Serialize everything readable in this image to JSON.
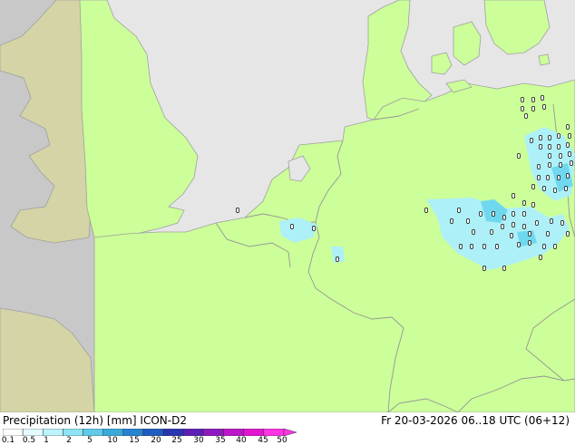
{
  "map": {
    "colors": {
      "land": "#ccff99",
      "sea": "#e6e6e6",
      "outside_domain": "#c8c8c8",
      "outside_domain_land": "#d4d4a6",
      "border": "#969696",
      "coast": "#a0a0a0",
      "precip_light": "#aef0f7",
      "precip_medium": "#70d8ee"
    }
  },
  "footer": {
    "title": "Precipitation (12h) [mm] ICON-D2",
    "valid_time": "Fr 20-03-2026 06..18 UTC (06+12)"
  },
  "legend": {
    "labels": [
      "0.1",
      "0.5",
      "1",
      "2",
      "5",
      "10",
      "15",
      "20",
      "25",
      "30",
      "35",
      "40",
      "45",
      "50"
    ],
    "colors": [
      "#ffffff",
      "#e4fbff",
      "#bdf3fb",
      "#8ee4f4",
      "#5fcbe9",
      "#3aa9dc",
      "#2783cf",
      "#1d5cc0",
      "#2a35b0",
      "#5b1fb4",
      "#8e19c0",
      "#bb16c9",
      "#e214d1",
      "#ff33e6"
    ]
  }
}
